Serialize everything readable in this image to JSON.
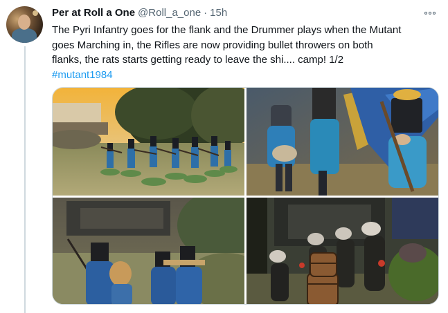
{
  "author": {
    "name": "Per at Roll a One",
    "handle": "@Roll_a_one",
    "separator": "·",
    "time": "15h"
  },
  "tweet": {
    "lines": [
      "The Pyri Infantry goes for the flank and the Drummer plays when the Mutant",
      "goes Marching in, the Rifles are now providing bullet throwers on both",
      "flanks, the rats starts getting ready to leave the shi.... camp! 1/2"
    ],
    "hashtag": "#mutant1984"
  },
  "icons": {
    "more": "more-options-icon"
  },
  "colors": {
    "text": "#0f1419",
    "secondary": "#536471",
    "link": "#1d9bf0",
    "border": "#cfd9de"
  }
}
